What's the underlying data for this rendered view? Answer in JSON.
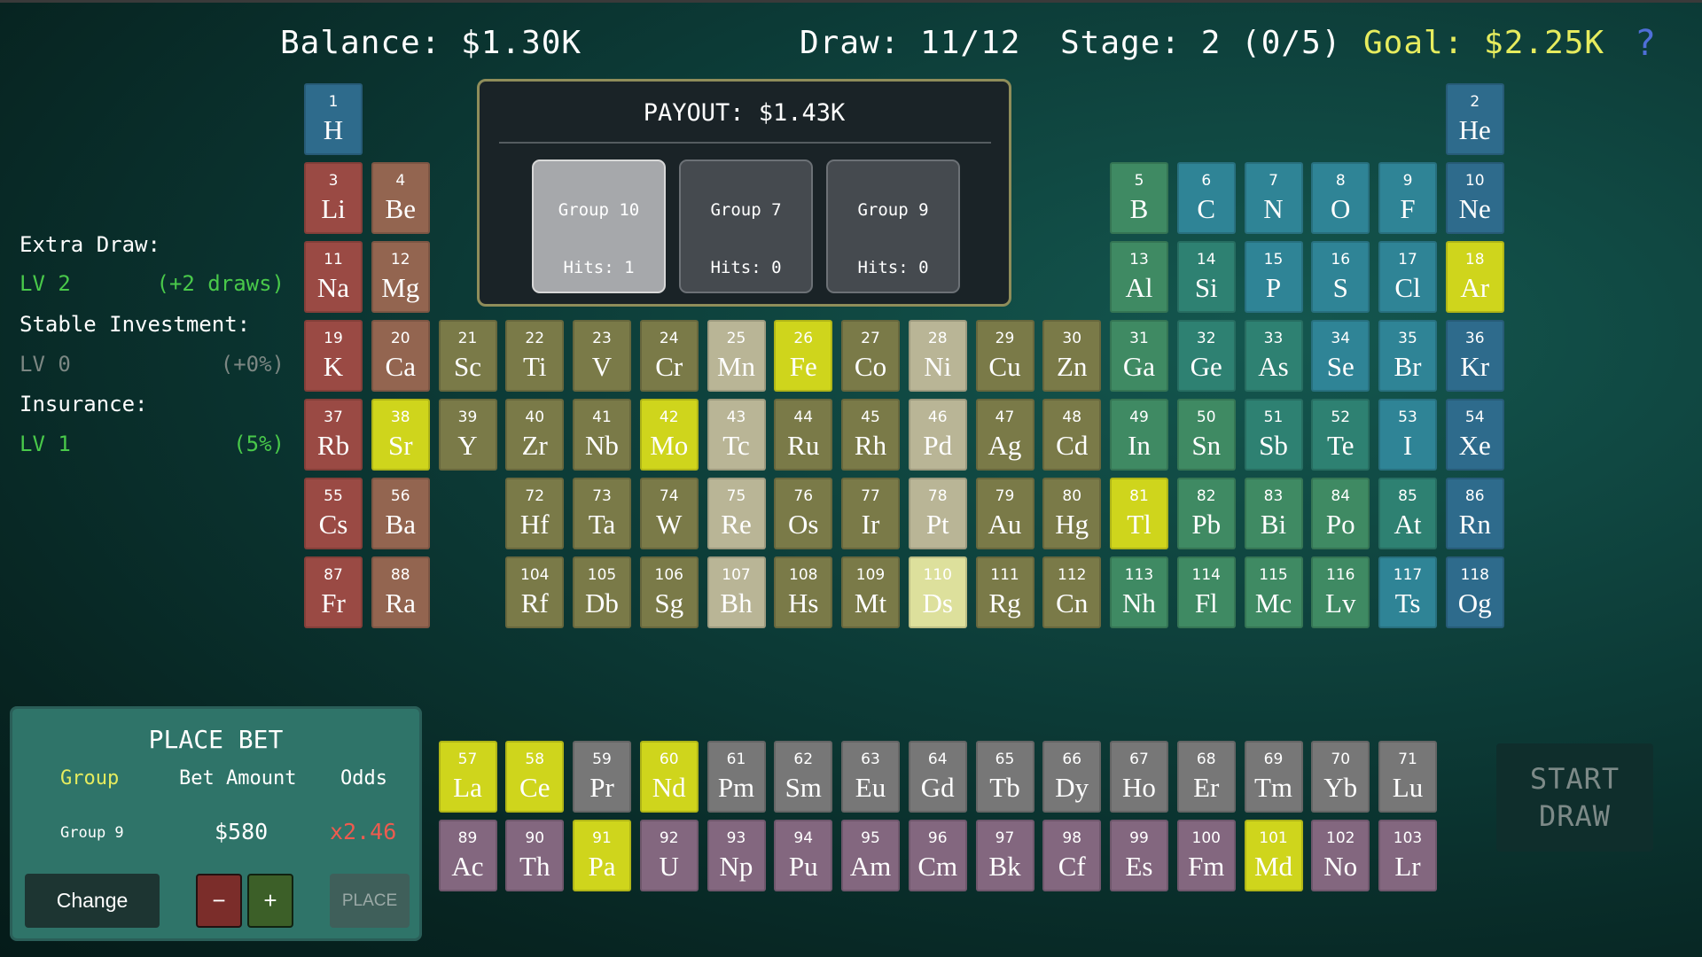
{
  "hud": {
    "balance": "Balance: $1.30K",
    "draw": "Draw: 11/12",
    "stage": "Stage: 2 (0/5)",
    "goal": "Goal: $2.25K",
    "help": "?"
  },
  "upgrades": {
    "extra_draw": {
      "label": "Extra Draw:",
      "level": "LV 2",
      "effect": "(+2 draws)"
    },
    "stable_investment": {
      "label": "Stable Investment:",
      "level": "LV 0",
      "effect": "(+0%)"
    },
    "insurance": {
      "label": "Insurance:",
      "level": "LV 1",
      "effect": "(5%)"
    }
  },
  "payout": {
    "title": "PAYOUT: $1.43K",
    "groups": [
      {
        "group": "Group 10",
        "hits": "Hits: 1",
        "selected": true
      },
      {
        "group": "Group 7",
        "hits": "Hits: 0",
        "selected": false
      },
      {
        "group": "Group 9",
        "hits": "Hits: 0",
        "selected": false
      }
    ]
  },
  "bet": {
    "title": "PLACE BET",
    "col_group": "Group",
    "col_amount": "Bet Amount",
    "col_odds": "Odds",
    "group_value": "Group 9",
    "amount_value": "$580",
    "odds_value": "x2.46",
    "change_label": "Change",
    "minus_label": "−",
    "plus_label": "+",
    "place_label": "PLACE"
  },
  "start_draw": {
    "line1": "START",
    "line2": "DRAW"
  },
  "colors": {
    "alkali": "#9a4a44",
    "alkaline_earth": "#936550",
    "transition": "#7a7a48",
    "transition_light": "#b9b596",
    "post_transition": "#3f8a63",
    "metalloid": "#2e8172",
    "nonmetal": "#2f8496",
    "noble": "#2e6b8c",
    "lanthanide": "#777777",
    "actinide": "#83677f",
    "highlight": "#cfd51c",
    "highlight_dim": "#dde09c",
    "goal_text": "#e6ec5e",
    "level_green": "#49c94a",
    "level_gray": "#7c8783",
    "odds_red": "#ee5b4f"
  },
  "elements": [
    {
      "n": "1",
      "s": "H",
      "c": "noble",
      "p": [
        1,
        1
      ]
    },
    {
      "n": "2",
      "s": "He",
      "c": "noble",
      "p": [
        1,
        18
      ]
    },
    {
      "n": "3",
      "s": "Li",
      "c": "alkali",
      "p": [
        2,
        1
      ]
    },
    {
      "n": "4",
      "s": "Be",
      "c": "alkaline_earth",
      "p": [
        2,
        2
      ]
    },
    {
      "n": "5",
      "s": "B",
      "c": "post_transition",
      "p": [
        2,
        13
      ]
    },
    {
      "n": "6",
      "s": "C",
      "c": "nonmetal",
      "p": [
        2,
        14
      ]
    },
    {
      "n": "7",
      "s": "N",
      "c": "nonmetal",
      "p": [
        2,
        15
      ]
    },
    {
      "n": "8",
      "s": "O",
      "c": "nonmetal",
      "p": [
        2,
        16
      ]
    },
    {
      "n": "9",
      "s": "F",
      "c": "nonmetal",
      "p": [
        2,
        17
      ]
    },
    {
      "n": "10",
      "s": "Ne",
      "c": "noble",
      "p": [
        2,
        18
      ]
    },
    {
      "n": "11",
      "s": "Na",
      "c": "alkali",
      "p": [
        3,
        1
      ]
    },
    {
      "n": "12",
      "s": "Mg",
      "c": "alkaline_earth",
      "p": [
        3,
        2
      ]
    },
    {
      "n": "13",
      "s": "Al",
      "c": "post_transition",
      "p": [
        3,
        13
      ]
    },
    {
      "n": "14",
      "s": "Si",
      "c": "metalloid",
      "p": [
        3,
        14
      ]
    },
    {
      "n": "15",
      "s": "P",
      "c": "nonmetal",
      "p": [
        3,
        15
      ]
    },
    {
      "n": "16",
      "s": "S",
      "c": "nonmetal",
      "p": [
        3,
        16
      ]
    },
    {
      "n": "17",
      "s": "Cl",
      "c": "nonmetal",
      "p": [
        3,
        17
      ]
    },
    {
      "n": "18",
      "s": "Ar",
      "c": "highlight",
      "p": [
        3,
        18
      ]
    },
    {
      "n": "19",
      "s": "K",
      "c": "alkali",
      "p": [
        4,
        1
      ]
    },
    {
      "n": "20",
      "s": "Ca",
      "c": "alkaline_earth",
      "p": [
        4,
        2
      ]
    },
    {
      "n": "21",
      "s": "Sc",
      "c": "transition",
      "p": [
        4,
        3
      ]
    },
    {
      "n": "22",
      "s": "Ti",
      "c": "transition",
      "p": [
        4,
        4
      ]
    },
    {
      "n": "23",
      "s": "V",
      "c": "transition",
      "p": [
        4,
        5
      ]
    },
    {
      "n": "24",
      "s": "Cr",
      "c": "transition",
      "p": [
        4,
        6
      ]
    },
    {
      "n": "25",
      "s": "Mn",
      "c": "transition_light",
      "p": [
        4,
        7
      ]
    },
    {
      "n": "26",
      "s": "Fe",
      "c": "highlight",
      "p": [
        4,
        8
      ]
    },
    {
      "n": "27",
      "s": "Co",
      "c": "transition",
      "p": [
        4,
        9
      ]
    },
    {
      "n": "28",
      "s": "Ni",
      "c": "transition_light",
      "p": [
        4,
        10
      ]
    },
    {
      "n": "29",
      "s": "Cu",
      "c": "transition",
      "p": [
        4,
        11
      ]
    },
    {
      "n": "30",
      "s": "Zn",
      "c": "transition",
      "p": [
        4,
        12
      ]
    },
    {
      "n": "31",
      "s": "Ga",
      "c": "post_transition",
      "p": [
        4,
        13
      ]
    },
    {
      "n": "32",
      "s": "Ge",
      "c": "metalloid",
      "p": [
        4,
        14
      ]
    },
    {
      "n": "33",
      "s": "As",
      "c": "metalloid",
      "p": [
        4,
        15
      ]
    },
    {
      "n": "34",
      "s": "Se",
      "c": "nonmetal",
      "p": [
        4,
        16
      ]
    },
    {
      "n": "35",
      "s": "Br",
      "c": "nonmetal",
      "p": [
        4,
        17
      ]
    },
    {
      "n": "36",
      "s": "Kr",
      "c": "noble",
      "p": [
        4,
        18
      ]
    },
    {
      "n": "37",
      "s": "Rb",
      "c": "alkali",
      "p": [
        5,
        1
      ]
    },
    {
      "n": "38",
      "s": "Sr",
      "c": "highlight",
      "p": [
        5,
        2
      ]
    },
    {
      "n": "39",
      "s": "Y",
      "c": "transition",
      "p": [
        5,
        3
      ]
    },
    {
      "n": "40",
      "s": "Zr",
      "c": "transition",
      "p": [
        5,
        4
      ]
    },
    {
      "n": "41",
      "s": "Nb",
      "c": "transition",
      "p": [
        5,
        5
      ]
    },
    {
      "n": "42",
      "s": "Mo",
      "c": "highlight",
      "p": [
        5,
        6
      ]
    },
    {
      "n": "43",
      "s": "Tc",
      "c": "transition_light",
      "p": [
        5,
        7
      ]
    },
    {
      "n": "44",
      "s": "Ru",
      "c": "transition",
      "p": [
        5,
        8
      ]
    },
    {
      "n": "45",
      "s": "Rh",
      "c": "transition",
      "p": [
        5,
        9
      ]
    },
    {
      "n": "46",
      "s": "Pd",
      "c": "transition_light",
      "p": [
        5,
        10
      ]
    },
    {
      "n": "47",
      "s": "Ag",
      "c": "transition",
      "p": [
        5,
        11
      ]
    },
    {
      "n": "48",
      "s": "Cd",
      "c": "transition",
      "p": [
        5,
        12
      ]
    },
    {
      "n": "49",
      "s": "In",
      "c": "post_transition",
      "p": [
        5,
        13
      ]
    },
    {
      "n": "50",
      "s": "Sn",
      "c": "post_transition",
      "p": [
        5,
        14
      ]
    },
    {
      "n": "51",
      "s": "Sb",
      "c": "metalloid",
      "p": [
        5,
        15
      ]
    },
    {
      "n": "52",
      "s": "Te",
      "c": "metalloid",
      "p": [
        5,
        16
      ]
    },
    {
      "n": "53",
      "s": "I",
      "c": "nonmetal",
      "p": [
        5,
        17
      ]
    },
    {
      "n": "54",
      "s": "Xe",
      "c": "noble",
      "p": [
        5,
        18
      ]
    },
    {
      "n": "55",
      "s": "Cs",
      "c": "alkali",
      "p": [
        6,
        1
      ]
    },
    {
      "n": "56",
      "s": "Ba",
      "c": "alkaline_earth",
      "p": [
        6,
        2
      ]
    },
    {
      "n": "72",
      "s": "Hf",
      "c": "transition",
      "p": [
        6,
        4
      ]
    },
    {
      "n": "73",
      "s": "Ta",
      "c": "transition",
      "p": [
        6,
        5
      ]
    },
    {
      "n": "74",
      "s": "W",
      "c": "transition",
      "p": [
        6,
        6
      ]
    },
    {
      "n": "75",
      "s": "Re",
      "c": "transition_light",
      "p": [
        6,
        7
      ]
    },
    {
      "n": "76",
      "s": "Os",
      "c": "transition",
      "p": [
        6,
        8
      ]
    },
    {
      "n": "77",
      "s": "Ir",
      "c": "transition",
      "p": [
        6,
        9
      ]
    },
    {
      "n": "78",
      "s": "Pt",
      "c": "transition_light",
      "p": [
        6,
        10
      ]
    },
    {
      "n": "79",
      "s": "Au",
      "c": "transition",
      "p": [
        6,
        11
      ]
    },
    {
      "n": "80",
      "s": "Hg",
      "c": "transition",
      "p": [
        6,
        12
      ]
    },
    {
      "n": "81",
      "s": "Tl",
      "c": "highlight",
      "p": [
        6,
        13
      ]
    },
    {
      "n": "82",
      "s": "Pb",
      "c": "post_transition",
      "p": [
        6,
        14
      ]
    },
    {
      "n": "83",
      "s": "Bi",
      "c": "post_transition",
      "p": [
        6,
        15
      ]
    },
    {
      "n": "84",
      "s": "Po",
      "c": "post_transition",
      "p": [
        6,
        16
      ]
    },
    {
      "n": "85",
      "s": "At",
      "c": "metalloid",
      "p": [
        6,
        17
      ]
    },
    {
      "n": "86",
      "s": "Rn",
      "c": "noble",
      "p": [
        6,
        18
      ]
    },
    {
      "n": "87",
      "s": "Fr",
      "c": "alkali",
      "p": [
        7,
        1
      ]
    },
    {
      "n": "88",
      "s": "Ra",
      "c": "alkaline_earth",
      "p": [
        7,
        2
      ]
    },
    {
      "n": "104",
      "s": "Rf",
      "c": "transition",
      "p": [
        7,
        4
      ]
    },
    {
      "n": "105",
      "s": "Db",
      "c": "transition",
      "p": [
        7,
        5
      ]
    },
    {
      "n": "106",
      "s": "Sg",
      "c": "transition",
      "p": [
        7,
        6
      ]
    },
    {
      "n": "107",
      "s": "Bh",
      "c": "transition_light",
      "p": [
        7,
        7
      ]
    },
    {
      "n": "108",
      "s": "Hs",
      "c": "transition",
      "p": [
        7,
        8
      ]
    },
    {
      "n": "109",
      "s": "Mt",
      "c": "transition",
      "p": [
        7,
        9
      ]
    },
    {
      "n": "110",
      "s": "Ds",
      "c": "highlight_dim",
      "p": [
        7,
        10
      ]
    },
    {
      "n": "111",
      "s": "Rg",
      "c": "transition",
      "p": [
        7,
        11
      ]
    },
    {
      "n": "112",
      "s": "Cn",
      "c": "transition",
      "p": [
        7,
        12
      ]
    },
    {
      "n": "113",
      "s": "Nh",
      "c": "post_transition",
      "p": [
        7,
        13
      ]
    },
    {
      "n": "114",
      "s": "Fl",
      "c": "post_transition",
      "p": [
        7,
        14
      ]
    },
    {
      "n": "115",
      "s": "Mc",
      "c": "post_transition",
      "p": [
        7,
        15
      ]
    },
    {
      "n": "116",
      "s": "Lv",
      "c": "post_transition",
      "p": [
        7,
        16
      ]
    },
    {
      "n": "117",
      "s": "Ts",
      "c": "nonmetal",
      "p": [
        7,
        17
      ]
    },
    {
      "n": "118",
      "s": "Og",
      "c": "noble",
      "p": [
        7,
        18
      ]
    },
    {
      "n": "57",
      "s": "La",
      "c": "highlight",
      "p": [
        9,
        3
      ]
    },
    {
      "n": "58",
      "s": "Ce",
      "c": "highlight",
      "p": [
        9,
        4
      ]
    },
    {
      "n": "59",
      "s": "Pr",
      "c": "lanthanide",
      "p": [
        9,
        5
      ]
    },
    {
      "n": "60",
      "s": "Nd",
      "c": "highlight",
      "p": [
        9,
        6
      ]
    },
    {
      "n": "61",
      "s": "Pm",
      "c": "lanthanide",
      "p": [
        9,
        7
      ]
    },
    {
      "n": "62",
      "s": "Sm",
      "c": "lanthanide",
      "p": [
        9,
        8
      ]
    },
    {
      "n": "63",
      "s": "Eu",
      "c": "lanthanide",
      "p": [
        9,
        9
      ]
    },
    {
      "n": "64",
      "s": "Gd",
      "c": "lanthanide",
      "p": [
        9,
        10
      ]
    },
    {
      "n": "65",
      "s": "Tb",
      "c": "lanthanide",
      "p": [
        9,
        11
      ]
    },
    {
      "n": "66",
      "s": "Dy",
      "c": "lanthanide",
      "p": [
        9,
        12
      ]
    },
    {
      "n": "67",
      "s": "Ho",
      "c": "lanthanide",
      "p": [
        9,
        13
      ]
    },
    {
      "n": "68",
      "s": "Er",
      "c": "lanthanide",
      "p": [
        9,
        14
      ]
    },
    {
      "n": "69",
      "s": "Tm",
      "c": "lanthanide",
      "p": [
        9,
        15
      ]
    },
    {
      "n": "70",
      "s": "Yb",
      "c": "lanthanide",
      "p": [
        9,
        16
      ]
    },
    {
      "n": "71",
      "s": "Lu",
      "c": "lanthanide",
      "p": [
        9,
        17
      ]
    },
    {
      "n": "89",
      "s": "Ac",
      "c": "actinide",
      "p": [
        10,
        3
      ]
    },
    {
      "n": "90",
      "s": "Th",
      "c": "actinide",
      "p": [
        10,
        4
      ]
    },
    {
      "n": "91",
      "s": "Pa",
      "c": "highlight",
      "p": [
        10,
        5
      ]
    },
    {
      "n": "92",
      "s": "U",
      "c": "actinide",
      "p": [
        10,
        6
      ]
    },
    {
      "n": "93",
      "s": "Np",
      "c": "actinide",
      "p": [
        10,
        7
      ]
    },
    {
      "n": "94",
      "s": "Pu",
      "c": "actinide",
      "p": [
        10,
        8
      ]
    },
    {
      "n": "95",
      "s": "Am",
      "c": "actinide",
      "p": [
        10,
        9
      ]
    },
    {
      "n": "96",
      "s": "Cm",
      "c": "actinide",
      "p": [
        10,
        10
      ]
    },
    {
      "n": "97",
      "s": "Bk",
      "c": "actinide",
      "p": [
        10,
        11
      ]
    },
    {
      "n": "98",
      "s": "Cf",
      "c": "actinide",
      "p": [
        10,
        12
      ]
    },
    {
      "n": "99",
      "s": "Es",
      "c": "actinide",
      "p": [
        10,
        13
      ]
    },
    {
      "n": "100",
      "s": "Fm",
      "c": "actinide",
      "p": [
        10,
        14
      ]
    },
    {
      "n": "101",
      "s": "Md",
      "c": "highlight",
      "p": [
        10,
        15
      ]
    },
    {
      "n": "102",
      "s": "No",
      "c": "actinide",
      "p": [
        10,
        16
      ]
    },
    {
      "n": "103",
      "s": "Lr",
      "c": "actinide",
      "p": [
        10,
        17
      ]
    }
  ]
}
